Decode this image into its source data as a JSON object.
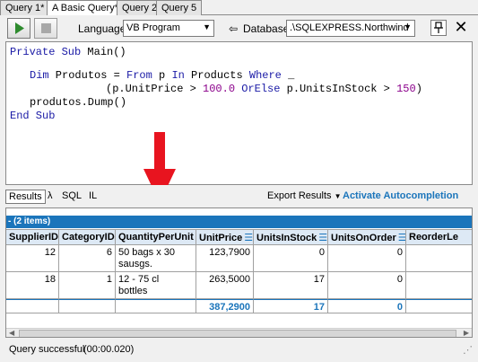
{
  "tabs": [
    "Query 1*",
    "A Basic Query*",
    "Query 2",
    "Query 5"
  ],
  "toolbar": {
    "language_label": "Language",
    "language_value": "VB Program",
    "database_label": "Database",
    "database_value": ".\\SQLEXPRESS.Northwind"
  },
  "code": {
    "l1_kw": "Private Sub",
    "l1_rest": " Main()",
    "l2_kw1": "Dim",
    "l2_mid": " Produtos = ",
    "l2_kw2": "From",
    "l2_mid2": " p ",
    "l2_kw3": "In",
    "l2_mid3": " Products ",
    "l2_kw4": "Where",
    "l2_end": " _",
    "l3_a": "(p.UnitPrice > ",
    "l3_num1": "100.0",
    "l3_kw": " OrElse ",
    "l3_b": "p.UnitsInStock > ",
    "l3_num2": "150",
    "l3_c": ")",
    "l4": "produtos.Dump()",
    "l5_kw": "End Sub"
  },
  "results_bar": {
    "results": "Results",
    "lambda": "λ",
    "sql": "SQL",
    "il": "IL",
    "export": "Export Results",
    "autocompletion": "Activate Autocompletion"
  },
  "grid": {
    "caption": "- (2 items)",
    "columns": [
      "SupplierID",
      "CategoryID",
      "QuantityPerUnit",
      "UnitPrice",
      "UnitsInStock",
      "UnitsOnOrder",
      "ReorderLe"
    ],
    "rows": [
      [
        "12",
        "6",
        "50 bags x 30",
        "123,7900",
        "0",
        "0",
        ""
      ],
      [
        "",
        "",
        "sausgs.",
        "",
        "",
        "",
        ""
      ],
      [
        "18",
        "1",
        "12 - 75 cl",
        "263,5000",
        "17",
        "0",
        ""
      ],
      [
        "",
        "",
        "bottles",
        "",
        "",
        "",
        ""
      ]
    ],
    "totals": [
      "",
      "",
      "",
      "387,2900",
      "17",
      "0",
      ""
    ]
  },
  "status": {
    "message": "Query successful",
    "time": "(00:00.020)"
  },
  "colors": {
    "accent": "#1b75bb",
    "arrow": "#e8141f",
    "keyword": "#1a1aa6",
    "number": "#8b008b"
  }
}
